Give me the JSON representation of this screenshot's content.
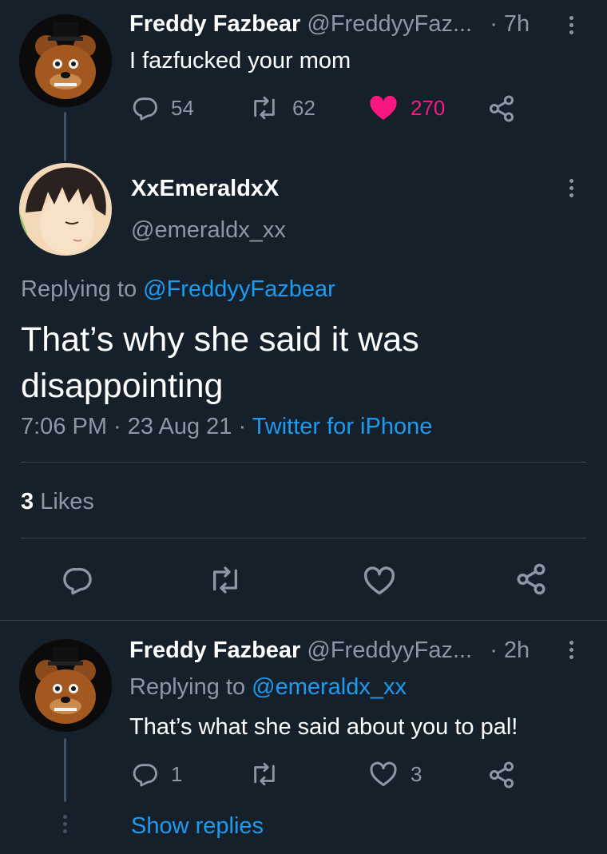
{
  "tweet1": {
    "display_name": "Freddy Fazbear",
    "handle": "@FreddyyFaz...",
    "time": "· 7h",
    "text": "I fazfucked your mom",
    "replies": "54",
    "retweets": "62",
    "likes": "270"
  },
  "main_tweet": {
    "display_name": "XxEmeraldxX",
    "handle": "@emeraldx_xx",
    "replying_prefix": "Replying to",
    "replying_to": "@FreddyyFazbear",
    "text": "That’s why she said it was disappointing",
    "timestamp": "7:06 PM · 23 Aug 21 ·",
    "source": "Twitter for iPhone",
    "likes_count": "3",
    "likes_label": "Likes"
  },
  "tweet3": {
    "display_name": "Freddy Fazbear",
    "handle": "@FreddyyFaz...",
    "time": "· 2h",
    "replying_prefix": "Replying to",
    "replying_to": "@emeraldx_xx",
    "text": "That’s what she said about you to pal!",
    "replies": "1",
    "retweets": "",
    "likes": "3"
  },
  "show_replies": "Show replies",
  "colors": {
    "background": "#15202b",
    "muted": "#8b98a5",
    "link": "#1d9bf0",
    "like_active": "#f91880",
    "divider": "#38444d"
  }
}
